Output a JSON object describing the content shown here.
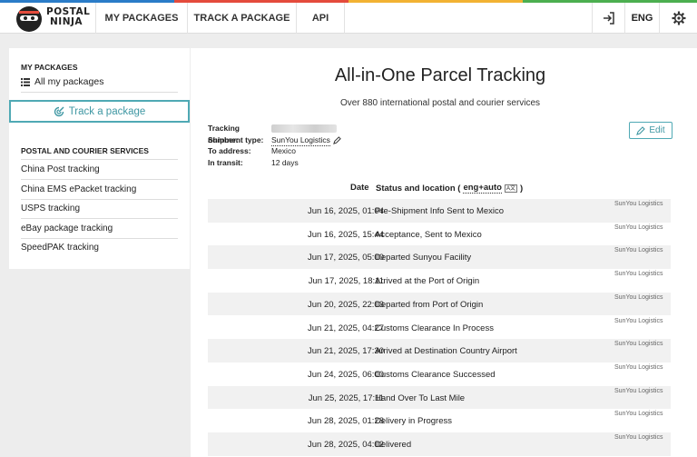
{
  "header": {
    "logo_line1": "POSTAL",
    "logo_line2": "NINJA",
    "nav": [
      "MY PACKAGES",
      "TRACK A PACKAGE",
      "API"
    ],
    "language": "ENG",
    "login_icon": "login-icon",
    "settings_icon": "gear-icon"
  },
  "sidebar": {
    "my_packages_heading": "MY PACKAGES",
    "all_packages": "All my packages",
    "track_button": "Track a package",
    "services_heading": "POSTAL AND COURIER SERVICES",
    "services": [
      "China Post tracking",
      "China EMS ePacket tracking",
      "USPS tracking",
      "eBay package tracking",
      "SpeedPAK tracking"
    ]
  },
  "main": {
    "title": "All-in-One Parcel Tracking",
    "subtitle": "Over 880 international postal and courier services",
    "edit_label": "Edit",
    "info": {
      "tracking_label": "Tracking number:",
      "shipment_label": "Shipment type:",
      "shipment_value": "SunYou Logistics",
      "address_label": "To address:",
      "address_value": "Mexico",
      "transit_label": "In transit:",
      "transit_value": "12 days"
    },
    "table": {
      "date_header": "Date",
      "status_header": "Status and location (",
      "lang_mode": "eng+auto",
      "status_header_end": ")"
    },
    "events": [
      {
        "date": "Jun 16, 2025, 01:04",
        "status": "Pre-Shipment Info Sent to Mexico",
        "carrier": "SunYou Logistics"
      },
      {
        "date": "Jun 16, 2025, 15:44",
        "status": "Acceptance, Sent to Mexico",
        "carrier": "SunYou Logistics"
      },
      {
        "date": "Jun 17, 2025, 05:00",
        "status": "Departed Sunyou Facility",
        "carrier": "SunYou Logistics"
      },
      {
        "date": "Jun 17, 2025, 18:11",
        "status": "Arrived at the Port of Origin",
        "carrier": "SunYou Logistics"
      },
      {
        "date": "Jun 20, 2025, 22:03",
        "status": "Departed from Port of Origin",
        "carrier": "SunYou Logistics"
      },
      {
        "date": "Jun 21, 2025, 04:27",
        "status": "Customs Clearance In Process",
        "carrier": "SunYou Logistics"
      },
      {
        "date": "Jun 21, 2025, 17:30",
        "status": "Arrived at Destination Country Airport",
        "carrier": "SunYou Logistics"
      },
      {
        "date": "Jun 24, 2025, 06:00",
        "status": "Customs Clearance Successed",
        "carrier": "SunYou Logistics"
      },
      {
        "date": "Jun 25, 2025, 17:11",
        "status": "Hand Over To Last Mile",
        "carrier": "SunYou Logistics"
      },
      {
        "date": "Jun 28, 2025, 01:28",
        "status": "Delivery in Progress",
        "carrier": "SunYou Logistics"
      },
      {
        "date": "Jun 28, 2025, 04:02",
        "status": "Delivered",
        "carrier": "SunYou Logistics"
      }
    ]
  }
}
